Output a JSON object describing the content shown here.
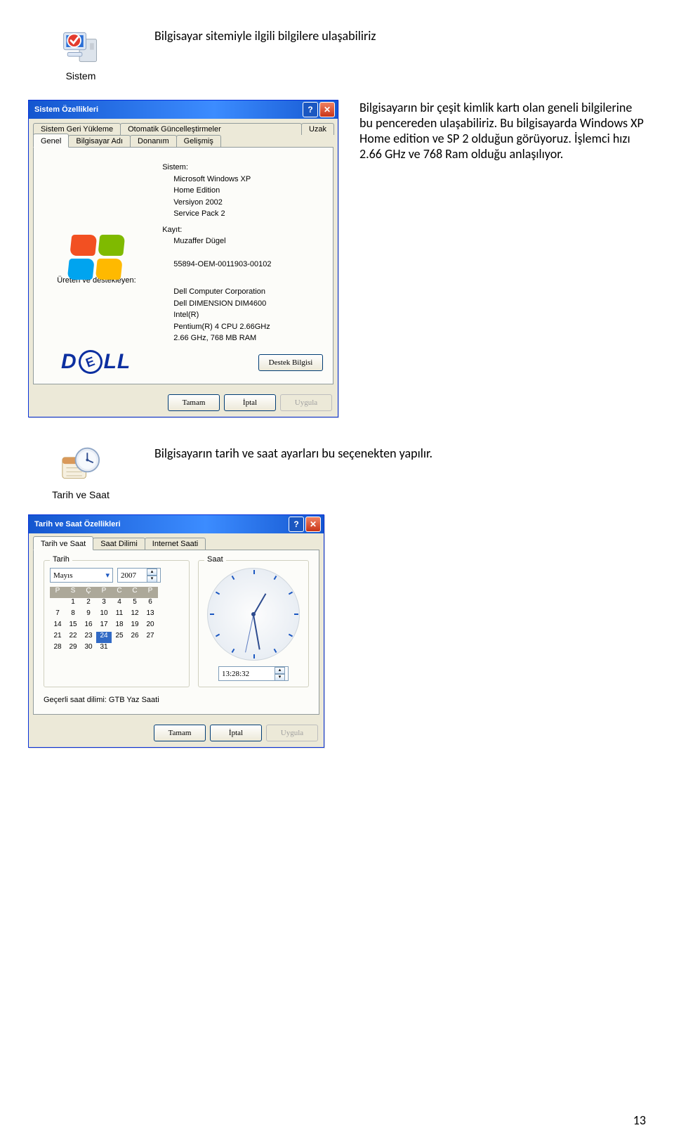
{
  "icons": {
    "system_label": "Sistem",
    "datetime_label": "Tarih ve Saat"
  },
  "captions": {
    "system": "Bilgisayar sitemiyle ilgili bilgilere ulaşabiliriz",
    "system_props": "Bilgisayarın bir çeşit kimlik kartı olan geneli bilgilerine bu pencereden ulaşabiliriz. Bu bilgisayarda Windows XP Home edition ve SP 2 olduğun görüyoruz. İşlemci hızı 2.66 GHz ve 768 Ram olduğu anlaşılıyor.",
    "datetime": "Bilgisayarın tarih ve saat ayarları bu seçenekten yapılır."
  },
  "sys_props": {
    "title": "Sistem Özellikleri",
    "tabs_row1": [
      "Sistem Geri Yükleme",
      "Otomatik Güncelleştirmeler",
      "Uzak"
    ],
    "tabs_row2": [
      "Genel",
      "Bilgisayar Adı",
      "Donanım",
      "Gelişmiş"
    ],
    "active_tab": "Genel",
    "section_system_hdr": "Sistem:",
    "system_lines": [
      "Microsoft Windows XP",
      "Home Edition",
      "Versiyon 2002",
      "Service Pack 2"
    ],
    "section_reg_hdr": "Kayıt:",
    "reg_lines": [
      "Muzaffer Dügel",
      "",
      "55894-OEM-0011903-00102"
    ],
    "section_mfr_hdr": "Üreten ve destekleyen:",
    "mfr_lines": [
      "Dell Computer Corporation",
      "Dell DIMENSION DIM4600",
      "Intel(R)",
      "Pentium(R) 4 CPU 2.66GHz",
      "2.66 GHz, 768 MB RAM"
    ],
    "support_btn": "Destek Bilgisi",
    "ok": "Tamam",
    "cancel": "İptal",
    "apply": "Uygula"
  },
  "dt_props": {
    "title": "Tarih ve Saat Özellikleri",
    "tabs": [
      "Tarih ve Saat",
      "Saat Dilimi",
      "Internet Saati"
    ],
    "active_tab": "Tarih ve Saat",
    "date_group": "Tarih",
    "time_group": "Saat",
    "month": "Mayıs",
    "year": "2007",
    "day_headers": [
      "P",
      "S",
      "Ç",
      "P",
      "C",
      "C",
      "P"
    ],
    "first_offset": 1,
    "days_in_month": 31,
    "selected_day": 24,
    "time_value": "13:28:32",
    "timezone_label": "Geçerli saat dilimi:  GTB Yaz Saati",
    "ok": "Tamam",
    "cancel": "İptal",
    "apply": "Uygula"
  },
  "page_number": "13"
}
